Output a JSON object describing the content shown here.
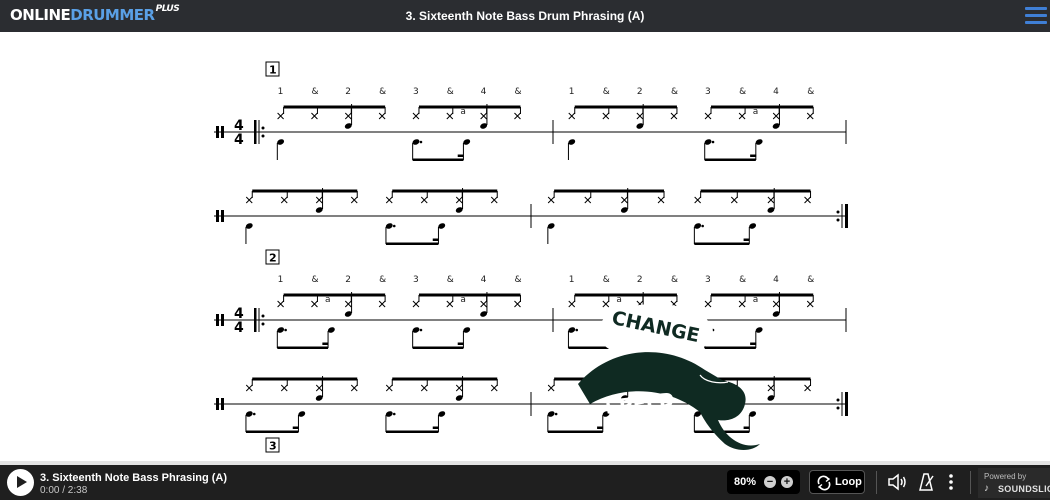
{
  "header": {
    "logo_main": "ONLINE",
    "logo_accent": "DRUMMER",
    "logo_plus": "PLUS",
    "title": "3. Sixteenth Note Bass Drum Phrasing (A)"
  },
  "score": {
    "sections": [
      "1",
      "2",
      "3"
    ],
    "time_signature": {
      "top": "4",
      "bottom": "4"
    },
    "counts": [
      "1",
      "&",
      "2",
      "&",
      "3",
      "&",
      "4",
      "&"
    ],
    "a_label": "a"
  },
  "overlay": {
    "word1": "CHANGE",
    "word2": "SPEED"
  },
  "player": {
    "track_title": "3. Sixteenth Note Bass Phrasing (A)",
    "time": "0:00 / 2:38",
    "speed": "80%",
    "minus": "−",
    "plus": "+",
    "loop": "Loop",
    "powered_by": "Powered by",
    "brand": "SOUNDSLICE"
  },
  "icons": {
    "play": "play-icon",
    "loop": "loop-icon",
    "volume": "volume-icon",
    "metronome": "metronome-icon",
    "more": "more-vertical-icon",
    "menu": "hamburger-menu-icon"
  },
  "colors": {
    "topbar": "#2b2d31",
    "accent": "#5aa0e6",
    "menu": "#3f7fd6",
    "player": "#1f1f1f"
  }
}
